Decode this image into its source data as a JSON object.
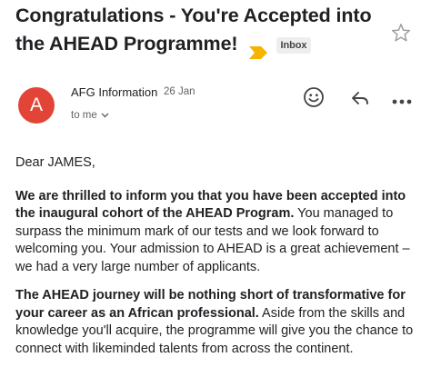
{
  "subject": {
    "line1": "Congratulations - You're Accepted into",
    "line2": "the AHEAD Programme!",
    "label": "Inbox",
    "important_color": "#f4b400"
  },
  "sender": {
    "avatar_letter": "A",
    "avatar_color": "#e24537",
    "name": "AFG Information",
    "date": "26 Jan",
    "recipient": "to me"
  },
  "actions": {
    "star_icon": "star-outline-icon",
    "emoji_icon": "emoji-icon",
    "reply_icon": "reply-icon",
    "more_icon": "more-horiz-icon"
  },
  "body": {
    "greeting": "Dear JAMES,",
    "p1_bold": "We are thrilled to inform you that you have been accepted into the inaugural cohort of the AHEAD Program.",
    "p1_rest": " You managed to surpass the minimum mark of our tests and we look forward to welcoming you. Your admission to AHEAD is a great achievement – we had a very large number of applicants.",
    "p2_bold": "The AHEAD journey will be nothing short of transformative for your career as an African professional.",
    "p2_rest": " Aside from the skills and knowledge you'll acquire, the programme will give you the chance to connect with likeminded talents from across the continent."
  }
}
